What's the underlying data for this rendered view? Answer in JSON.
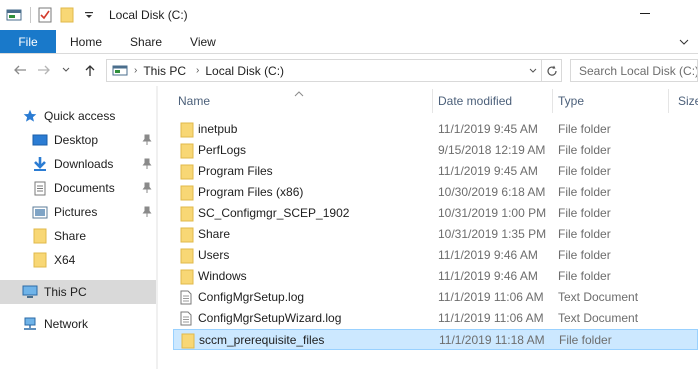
{
  "window": {
    "title": "Local Disk (C:)"
  },
  "ribbon": {
    "tabs": [
      "File",
      "Home",
      "Share",
      "View"
    ]
  },
  "address": {
    "crumbs": [
      "This PC",
      "Local Disk (C:)"
    ],
    "search_placeholder": "Search Local Disk (C:)"
  },
  "nav": {
    "items": [
      {
        "label": "Quick access",
        "icon": "star-icon",
        "pinned": false
      },
      {
        "label": "Desktop",
        "icon": "desktop-icon",
        "pinned": true
      },
      {
        "label": "Downloads",
        "icon": "download-icon",
        "pinned": true
      },
      {
        "label": "Documents",
        "icon": "document-icon",
        "pinned": true
      },
      {
        "label": "Pictures",
        "icon": "picture-icon",
        "pinned": true
      },
      {
        "label": "Share",
        "icon": "folder-icon",
        "pinned": false
      },
      {
        "label": "X64",
        "icon": "folder-icon",
        "pinned": false
      },
      {
        "label": "This PC",
        "icon": "computer-icon",
        "pinned": false,
        "selected": true
      },
      {
        "label": "Network",
        "icon": "network-icon",
        "pinned": false
      }
    ]
  },
  "columns": {
    "name": "Name",
    "date": "Date modified",
    "type": "Type",
    "size": "Size"
  },
  "files": [
    {
      "name": "inetpub",
      "date": "11/1/2019 9:45 AM",
      "type": "File folder",
      "kind": "folder"
    },
    {
      "name": "PerfLogs",
      "date": "9/15/2018 12:19 AM",
      "type": "File folder",
      "kind": "folder"
    },
    {
      "name": "Program Files",
      "date": "11/1/2019 9:45 AM",
      "type": "File folder",
      "kind": "folder"
    },
    {
      "name": "Program Files (x86)",
      "date": "10/30/2019 6:18 AM",
      "type": "File folder",
      "kind": "folder"
    },
    {
      "name": "SC_Configmgr_SCEP_1902",
      "date": "10/31/2019 1:00 PM",
      "type": "File folder",
      "kind": "folder"
    },
    {
      "name": "Share",
      "date": "10/31/2019 1:35 PM",
      "type": "File folder",
      "kind": "folder"
    },
    {
      "name": "Users",
      "date": "11/1/2019 9:46 AM",
      "type": "File folder",
      "kind": "folder"
    },
    {
      "name": "Windows",
      "date": "11/1/2019 9:46 AM",
      "type": "File folder",
      "kind": "folder"
    },
    {
      "name": "ConfigMgrSetup.log",
      "date": "11/1/2019 11:06 AM",
      "type": "Text Document",
      "kind": "text"
    },
    {
      "name": "ConfigMgrSetupWizard.log",
      "date": "11/1/2019 11:06 AM",
      "type": "Text Document",
      "kind": "text"
    },
    {
      "name": "sccm_prerequisite_files",
      "date": "11/1/2019 11:18 AM",
      "type": "File folder",
      "kind": "folder",
      "selected": true
    }
  ],
  "colors": {
    "accent": "#1979ca",
    "folder": "#f8d775",
    "selection": "#cce8ff"
  }
}
